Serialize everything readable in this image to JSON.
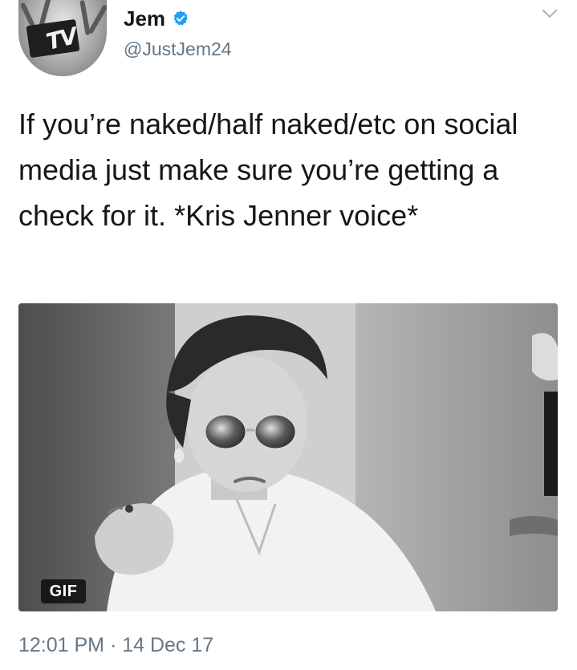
{
  "author": {
    "name": "Jem",
    "handle": "@JustJem24",
    "verified": true,
    "avatar_icon": "mtv-logo-avatar",
    "avatar_logo_text": "TV"
  },
  "tweet": {
    "text": "If you’re naked/half naked/etc on social media just make sure you’re getting a check for it. *Kris Jenner voice*"
  },
  "media": {
    "badge": "GIF",
    "description_icon": "gif-image"
  },
  "meta": {
    "timestamp": "12:01 PM · 14 Dec 17"
  },
  "colors": {
    "text": "#14171a",
    "secondary": "#657786",
    "verified_badge": "#1da1f2"
  }
}
